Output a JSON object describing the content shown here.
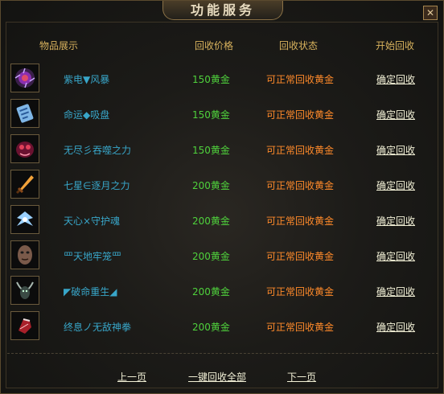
{
  "window": {
    "title": "功能服务",
    "close_glyph": "✕"
  },
  "columns": {
    "item": "物品展示",
    "price": "回收价格",
    "status": "回收状态",
    "action": "开始回收"
  },
  "items": [
    {
      "name": "紫电▼风暴",
      "price": "150黄金",
      "status": "可正常回收黄金",
      "action": "确定回收",
      "icon": "purple-orb-icon"
    },
    {
      "name": "命运◆吸盘",
      "price": "150黄金",
      "status": "可正常回收黄金",
      "action": "确定回收",
      "icon": "blue-scroll-icon"
    },
    {
      "name": "无尽彡吞噬之力",
      "price": "150黄金",
      "status": "可正常回收黄金",
      "action": "确定回收",
      "icon": "crimson-beast-icon"
    },
    {
      "name": "七星∈逐月之力",
      "price": "200黄金",
      "status": "可正常回收黄金",
      "action": "确定回收",
      "icon": "flame-sword-icon"
    },
    {
      "name": "天心×守护魂",
      "price": "200黄金",
      "status": "可正常回收黄金",
      "action": "确定回收",
      "icon": "winged-spirit-icon"
    },
    {
      "name": "罒天地牢笼罒",
      "price": "200黄金",
      "status": "可正常回收黄金",
      "action": "确定回收",
      "icon": "stone-mask-icon"
    },
    {
      "name": "◤破命重生◢",
      "price": "200黄金",
      "status": "可正常回收黄金",
      "action": "确定回收",
      "icon": "horned-demon-icon"
    },
    {
      "name": "终息ノ无敌神拳",
      "price": "200黄金",
      "status": "可正常回收黄金",
      "action": "确定回收",
      "icon": "red-gauntlet-icon"
    }
  ],
  "footer": {
    "prev": "上一页",
    "recycle_all": "一键回收全部",
    "next": "下一页"
  }
}
